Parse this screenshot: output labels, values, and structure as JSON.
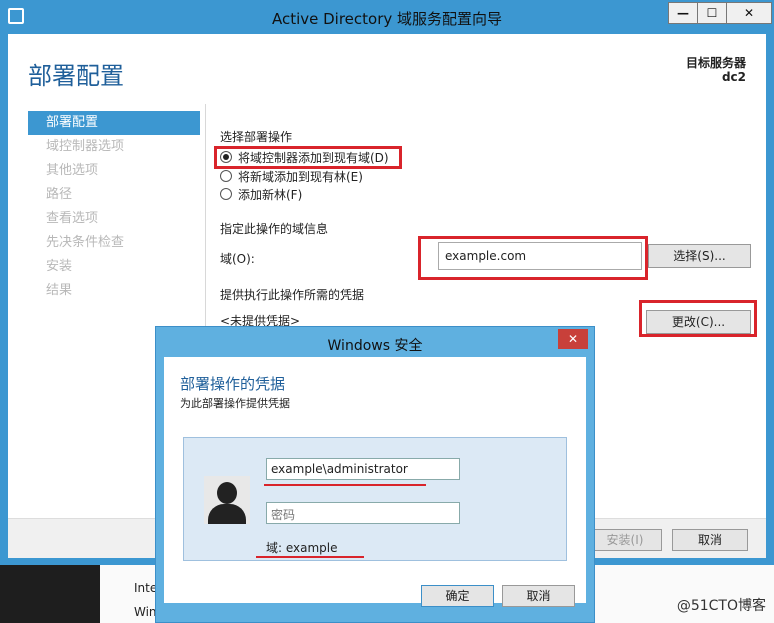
{
  "window": {
    "title": "Active Directory 域服务配置向导",
    "min_glyph": "—",
    "max_glyph": "☐",
    "close_glyph": "✕"
  },
  "header": {
    "page_title": "部署配置",
    "target_label": "目标服务器",
    "target_value": "dc2"
  },
  "nav": {
    "items": [
      {
        "label": "部署配置",
        "active": true
      },
      {
        "label": "域控制器选项",
        "active": false
      },
      {
        "label": "其他选项",
        "active": false
      },
      {
        "label": "路径",
        "active": false
      },
      {
        "label": "查看选项",
        "active": false
      },
      {
        "label": "先决条件检查",
        "active": false
      },
      {
        "label": "安装",
        "active": false
      },
      {
        "label": "结果",
        "active": false
      }
    ]
  },
  "main": {
    "operation_label": "选择部署操作",
    "options": [
      {
        "label": "将域控制器添加到现有域(D)",
        "checked": true
      },
      {
        "label": "将新域添加到现有林(E)",
        "checked": false
      },
      {
        "label": "添加新林(F)",
        "checked": false
      }
    ],
    "domain_info_label": "指定此操作的域信息",
    "domain_field_label": "域(O):",
    "domain_value": "example.com",
    "select_button": "选择(S)...",
    "credentials_label": "提供执行此操作所需的凭据",
    "credentials_status": "<未提供凭据>",
    "change_button": "更改(C)..."
  },
  "footer": {
    "install_button": "安装(I)",
    "cancel_button": "取消"
  },
  "dialog": {
    "title": "Windows 安全",
    "close_glyph": "✕",
    "heading": "部署操作的凭据",
    "subheading": "为此部署操作提供凭据",
    "username_value": "example\\administrator",
    "password_placeholder": "密码",
    "domain_text": "域: example",
    "ok_button": "确定",
    "cancel_button": "取消"
  },
  "background": {
    "text1": "Inte",
    "text2": "Win",
    "watermark": "@51CTO博客"
  },
  "colors": {
    "accent": "#3c97d1",
    "highlight_red": "#d9242b",
    "title_blue": "#1f5f9a"
  }
}
